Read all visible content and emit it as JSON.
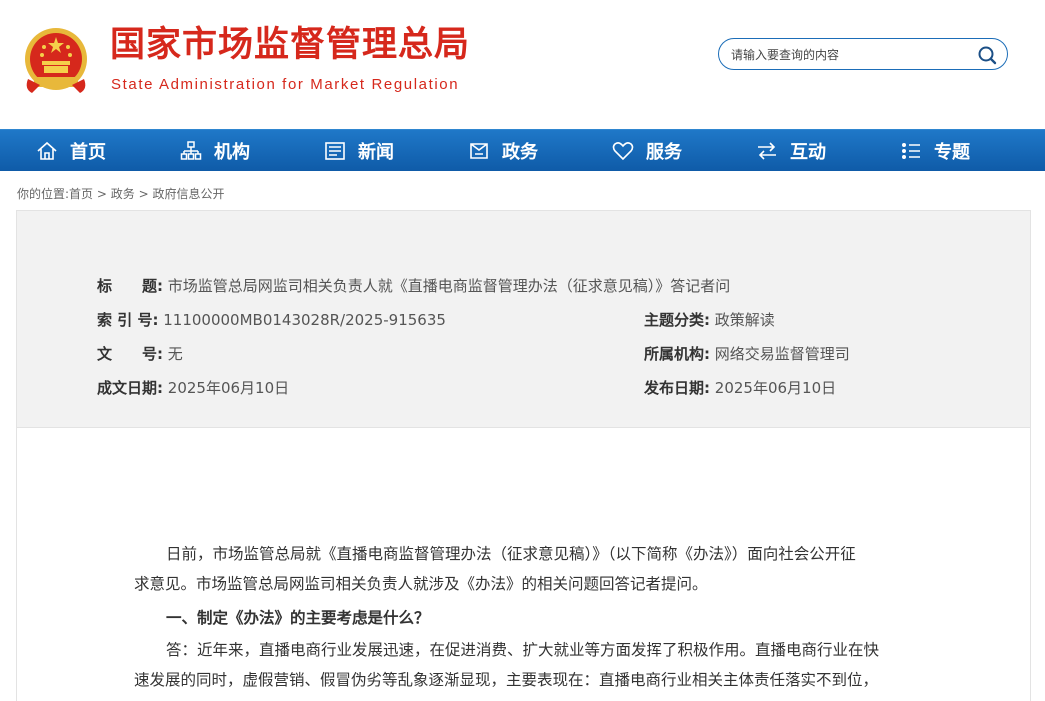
{
  "header": {
    "title_cn": "国家市场监督管理总局",
    "title_en": "State Administration for Market Regulation",
    "search_placeholder": "请输入要查询的内容"
  },
  "nav": {
    "items": [
      {
        "label": "首页",
        "icon": "home-icon"
      },
      {
        "label": "机构",
        "icon": "org-chart-icon"
      },
      {
        "label": "新闻",
        "icon": "news-icon"
      },
      {
        "label": "政务",
        "icon": "government-affairs-icon"
      },
      {
        "label": "服务",
        "icon": "heart-icon"
      },
      {
        "label": "互动",
        "icon": "exchange-arrows-icon"
      },
      {
        "label": "专题",
        "icon": "topics-icon"
      }
    ]
  },
  "breadcrumb": {
    "prefix": "你的位置:",
    "items": [
      "首页",
      "政务",
      "政府信息公开"
    ],
    "separator": " > "
  },
  "meta": {
    "title_label": "标　　题:",
    "title_value": "市场监管总局网监司相关负责人就《直播电商监督管理办法（征求意见稿）》答记者问",
    "index_label": "索 引 号:",
    "index_value": "11100000MB0143028R/2025-915635",
    "topic_label": "主题分类:",
    "topic_value": "政策解读",
    "docno_label": "文　　号:",
    "docno_value": "无",
    "org_label": "所属机构:",
    "org_value": "网络交易监督管理司",
    "written_label": "成文日期:",
    "written_value": "2025年06月10日",
    "published_label": "发布日期:",
    "published_value": "2025年06月10日"
  },
  "article": {
    "p1_line1": "日前，市场监管总局就《直播电商监督管理办法（征求意见稿）》（以下简称《办法》）面向社会公开征",
    "p1_line2": "求意见。市场监管总局网监司相关负责人就涉及《办法》的相关问题回答记者提问。",
    "heading1": "一、制定《办法》的主要考虑是什么？",
    "p2_line1": "答：近年来，直播电商行业发展迅速，在促进消费、扩大就业等方面发挥了积极作用。直播电商行业在快",
    "p2_line2": "速发展的同时，虚假营销、假冒伪劣等乱象逐渐显现，主要表现在：直播电商行业相关主体责任落实不到位，"
  },
  "colors": {
    "brand_red": "#d6281c",
    "nav_blue": "#1366b3",
    "meta_bg": "#f2f2f2"
  }
}
